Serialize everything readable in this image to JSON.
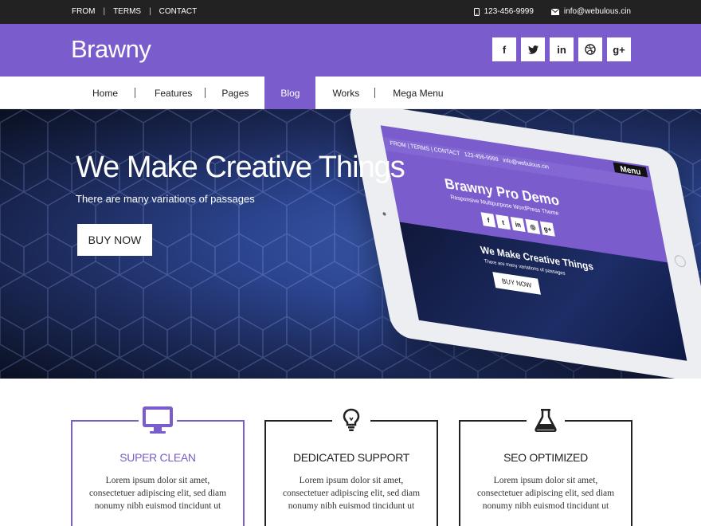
{
  "topbar": {
    "links": [
      "FROM",
      "TERMS",
      "CONTACT"
    ],
    "separator": "|",
    "phone": "123-456-9999",
    "email": "info@webulous.cin"
  },
  "header": {
    "logo": "Brawny",
    "social": [
      {
        "icon": "facebook-icon",
        "glyph": "f"
      },
      {
        "icon": "twitter-icon",
        "glyph": "t"
      },
      {
        "icon": "linkedin-icon",
        "glyph": "in"
      },
      {
        "icon": "dribbble-icon",
        "glyph": "◎"
      },
      {
        "icon": "google-plus-icon",
        "glyph": "g+"
      }
    ]
  },
  "nav": {
    "items": [
      "Home",
      "Features",
      "Pages",
      "Blog",
      "Works",
      "Mega Menu"
    ],
    "active": "Blog"
  },
  "hero": {
    "title": "We Make Creative Things",
    "subtitle": "There are many variations of passages",
    "button": "BUY NOW"
  },
  "tablet_screen": {
    "menu": "Menu",
    "top_links": "FROM | TERMS | CONTACT",
    "phone": "123-456-9999",
    "email": "info@webulous.cin",
    "brand": "Brawny Pro Demo",
    "tagline": "Responsive Multipurpose WordPress Theme",
    "hero_title": "We Make Creative Things",
    "hero_sub": "There are many variations of passages",
    "hero_button": "BUY NOW"
  },
  "features": [
    {
      "title": "SUPER CLEAN",
      "icon": "monitor-icon",
      "text": "Lorem ipsum dolor sit amet, consectetuer adipiscing elit, sed diam nonumy nibh euismod tincidunt ut"
    },
    {
      "title": "DEDICATED SUPPORT",
      "icon": "lightbulb-icon",
      "text": "Lorem ipsum dolor sit amet, consectetuer adipiscing elit, sed diam nonumy nibh euismod tincidunt ut"
    },
    {
      "title": "SEO OPTIMIZED",
      "icon": "flask-icon",
      "text": "Lorem ipsum dolor sit amet, consectetuer adipiscing elit, sed diam nonumy nibh euismod tincidunt ut"
    }
  ],
  "colors": {
    "accent": "#7a5ccd",
    "topbar": "#222222"
  }
}
